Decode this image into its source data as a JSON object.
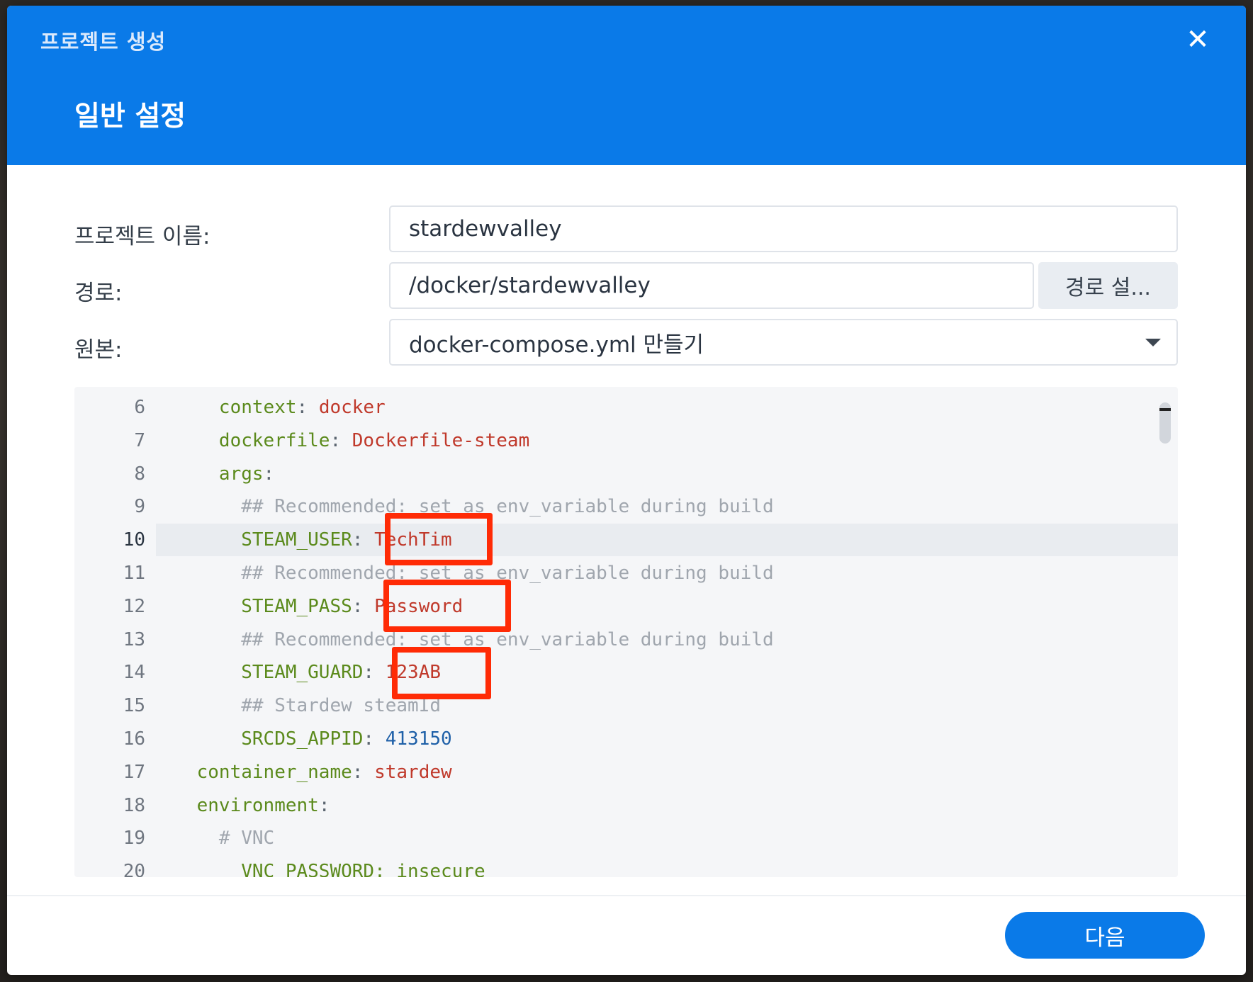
{
  "dialog": {
    "window_title": "프로젝트 생성",
    "close_icon": "close-icon",
    "section_title": "일반 설정"
  },
  "form": {
    "project_name_label": "프로젝트 이름:",
    "project_name_value": "stardewvalley",
    "path_label": "경로:",
    "path_value": "/docker/stardewvalley",
    "path_button": "경로 설...",
    "source_label": "원본:",
    "source_value": "docker-compose.yml 만들기"
  },
  "editor": {
    "lines": [
      {
        "n": "6",
        "indent": "      ",
        "parts": [
          {
            "t": "context",
            "c": "key"
          },
          {
            "t": ": ",
            "c": "punct"
          },
          {
            "t": "docker",
            "c": "str"
          }
        ]
      },
      {
        "n": "7",
        "indent": "      ",
        "parts": [
          {
            "t": "dockerfile",
            "c": "key"
          },
          {
            "t": ": ",
            "c": "punct"
          },
          {
            "t": "Dockerfile-steam",
            "c": "str"
          }
        ]
      },
      {
        "n": "8",
        "indent": "      ",
        "parts": [
          {
            "t": "args",
            "c": "key"
          },
          {
            "t": ":",
            "c": "punct"
          }
        ]
      },
      {
        "n": "9",
        "indent": "        ",
        "parts": [
          {
            "t": "## Recommended: set as env_variable during build",
            "c": "cmt"
          }
        ]
      },
      {
        "n": "10",
        "indent": "        ",
        "active": true,
        "parts": [
          {
            "t": "STEAM_USER",
            "c": "key"
          },
          {
            "t": ": ",
            "c": "punct"
          },
          {
            "t": "TechTim",
            "c": "str"
          }
        ]
      },
      {
        "n": "11",
        "indent": "        ",
        "parts": [
          {
            "t": "## Recommended: set as env_variable during build",
            "c": "cmt"
          }
        ]
      },
      {
        "n": "12",
        "indent": "        ",
        "parts": [
          {
            "t": "STEAM_PASS",
            "c": "key"
          },
          {
            "t": ": ",
            "c": "punct"
          },
          {
            "t": "Password",
            "c": "str"
          }
        ]
      },
      {
        "n": "13",
        "indent": "        ",
        "parts": [
          {
            "t": "## Recommended: set as env_variable during build",
            "c": "cmt"
          }
        ]
      },
      {
        "n": "14",
        "indent": "        ",
        "parts": [
          {
            "t": "STEAM_GUARD",
            "c": "key"
          },
          {
            "t": ": ",
            "c": "punct"
          },
          {
            "t": "123AB",
            "c": "str"
          }
        ]
      },
      {
        "n": "15",
        "indent": "        ",
        "parts": [
          {
            "t": "## Stardew steamId",
            "c": "cmt"
          }
        ]
      },
      {
        "n": "16",
        "indent": "        ",
        "parts": [
          {
            "t": "SRCDS_APPID",
            "c": "key"
          },
          {
            "t": ": ",
            "c": "punct"
          },
          {
            "t": "413150",
            "c": "num"
          }
        ]
      },
      {
        "n": "17",
        "indent": "    ",
        "parts": [
          {
            "t": "container_name",
            "c": "key"
          },
          {
            "t": ": ",
            "c": "punct"
          },
          {
            "t": "stardew",
            "c": "str"
          }
        ]
      },
      {
        "n": "18",
        "indent": "    ",
        "parts": [
          {
            "t": "environment",
            "c": "key"
          },
          {
            "t": ":",
            "c": "punct"
          }
        ]
      },
      {
        "n": "19",
        "indent": "      ",
        "parts": [
          {
            "t": "# VNC",
            "c": "cmt"
          }
        ]
      },
      {
        "n": "20",
        "indent": "        ",
        "parts": [
          {
            "t": "VNC_PASSWORD: insecure",
            "c": "key"
          }
        ]
      }
    ]
  },
  "footer": {
    "next_button": "다음"
  },
  "colors": {
    "accent": "#0a7ae8",
    "highlight_box": "#ff2b06"
  }
}
